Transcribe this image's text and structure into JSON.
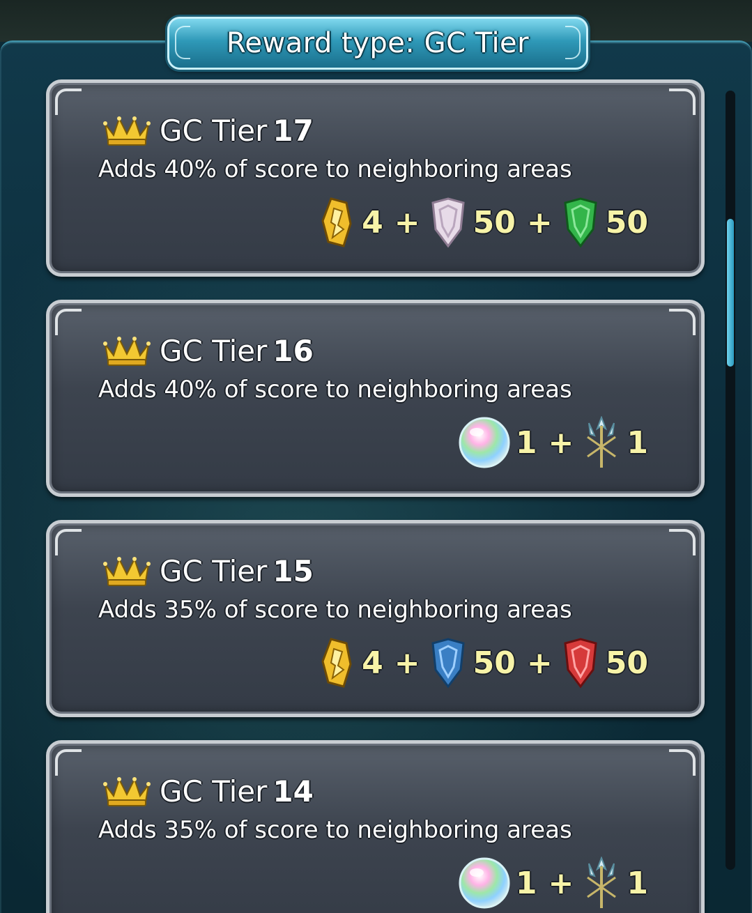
{
  "header": {
    "title": "Reward type: GC Tier"
  },
  "tiers": [
    {
      "title": "GC Tier",
      "number": "17",
      "description": "Adds 40% of score to neighboring areas",
      "rewards": [
        {
          "icon": "grail-icon",
          "qty": "4"
        },
        {
          "icon": "white-badge-icon",
          "qty": "50"
        },
        {
          "icon": "green-badge-icon",
          "qty": "50"
        }
      ]
    },
    {
      "title": "GC Tier",
      "number": "16",
      "description": "Adds 40% of score to neighboring areas",
      "rewards": [
        {
          "icon": "rainbow-orb-icon",
          "qty": "1"
        },
        {
          "icon": "trident-icon",
          "qty": "1"
        }
      ]
    },
    {
      "title": "GC Tier",
      "number": "15",
      "description": "Adds 35% of score to neighboring areas",
      "rewards": [
        {
          "icon": "grail-icon",
          "qty": "4"
        },
        {
          "icon": "blue-badge-icon",
          "qty": "50"
        },
        {
          "icon": "red-badge-icon",
          "qty": "50"
        }
      ]
    },
    {
      "title": "GC Tier",
      "number": "14",
      "description": "Adds 35% of score to neighboring areas",
      "rewards": [
        {
          "icon": "rainbow-orb-icon",
          "qty": "1"
        },
        {
          "icon": "trident-icon",
          "qty": "1"
        }
      ]
    }
  ],
  "separator": "+",
  "colors": {
    "accent": "#2f99b8",
    "qty_text": "#f7f3a8",
    "card_bg": "#3d444f",
    "card_border": "#c8cdd2"
  }
}
